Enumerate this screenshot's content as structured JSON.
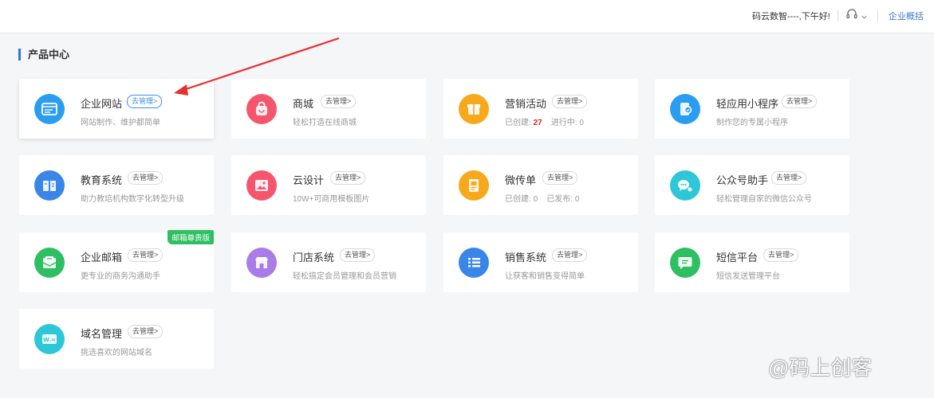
{
  "header": {
    "greeting": "码云数智----,下午好!",
    "overview_label": "企业概括",
    "icons": [
      "headset-icon",
      "chevron-down-icon"
    ]
  },
  "section_title": "产品中心",
  "manage_label": "去管理>",
  "cards": [
    {
      "name": "企业网站",
      "desc": "网站制作、维护都简单",
      "icon": "website-icon",
      "color": "#2b9df0"
    },
    {
      "name": "商城",
      "desc": "轻松打造在线商城",
      "icon": "shopping-bag-icon",
      "color": "#f5566d"
    },
    {
      "name": "营销活动",
      "desc_created_label": "已创建:",
      "desc_created_value": "27",
      "desc_running_label": "进行中:",
      "desc_running_value": "0",
      "icon": "gift-icon",
      "color": "#f7a81b"
    },
    {
      "name": "轻应用小程序",
      "desc": "制作您的专属小程序",
      "icon": "mini-program-icon",
      "color": "#2b9df0"
    },
    {
      "name": "教育系统",
      "desc": "助力教培机构数字化转型升级",
      "icon": "book-icon",
      "color": "#3a86e8"
    },
    {
      "name": "云设计",
      "desc": "10W+可商用模板图片",
      "icon": "image-icon",
      "color": "#f5566d"
    },
    {
      "name": "微传单",
      "desc_created_label": "已创建:",
      "desc_created_value": "0",
      "desc_running_label": "已发布:",
      "desc_running_value": "0",
      "icon": "flyer-icon",
      "color": "#f7a81b"
    },
    {
      "name": "公众号助手",
      "desc": "轻松管理自家的微信公众号",
      "icon": "wechat-icon",
      "color": "#2ec7d8"
    },
    {
      "name": "企业邮箱",
      "desc": "更专业的商务沟通助手",
      "badge": "邮箱尊贵版",
      "icon": "mail-icon",
      "color": "#2fbf63"
    },
    {
      "name": "门店系统",
      "desc": "轻松搞定会员管理和会员营销",
      "icon": "store-icon",
      "color": "#a97ce8"
    },
    {
      "name": "销售系统",
      "desc": "让获客和销售变得简单",
      "icon": "list-icon",
      "color": "#3a86e8"
    },
    {
      "name": "短信平台",
      "desc": "短信发送管理平台",
      "icon": "sms-icon",
      "color": "#2fbf63"
    },
    {
      "name": "域名管理",
      "desc": "挑选喜欢的网站域名",
      "icon": "domain-icon",
      "color": "#2ec7d8"
    }
  ],
  "watermark": "@码上创客"
}
